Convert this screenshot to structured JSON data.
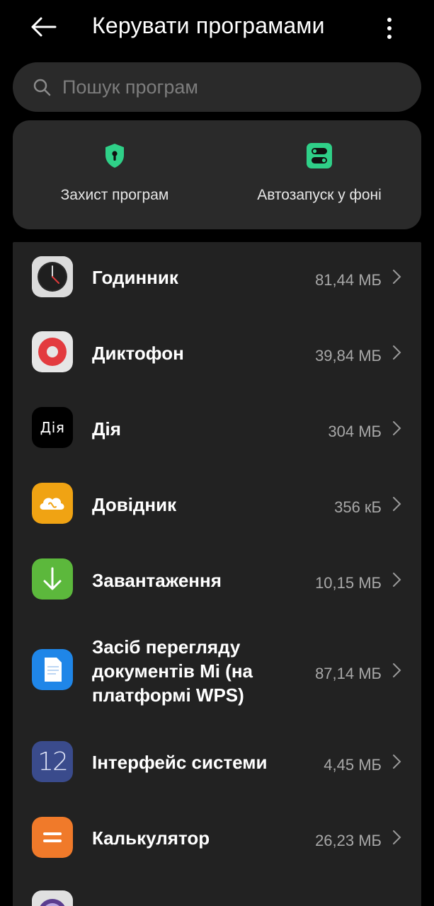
{
  "header": {
    "title": "Керувати програмами",
    "back_icon": "arrow-left-icon",
    "menu_icon": "more-vertical-icon"
  },
  "search": {
    "placeholder": "Пошук програм",
    "icon": "search-icon"
  },
  "quick_actions": [
    {
      "label": "Захист програм",
      "icon": "shield-lock-icon",
      "color": "#2fd088"
    },
    {
      "label": "Автозапуск у фоні",
      "icon": "toggle-switches-icon",
      "color": "#2fd088"
    }
  ],
  "apps": [
    {
      "name": "Годинник",
      "size": "81,44 МБ",
      "icon": "clock-app-icon"
    },
    {
      "name": "Диктофон",
      "size": "39,84 МБ",
      "icon": "recorder-app-icon"
    },
    {
      "name": "Дія",
      "size": "304 МБ",
      "icon": "diia-app-icon",
      "icon_text": "Дія"
    },
    {
      "name": "Довідник",
      "size": "356 кБ",
      "icon": "directory-app-icon"
    },
    {
      "name": "Завантаження",
      "size": "10,15 МБ",
      "icon": "downloads-app-icon"
    },
    {
      "name": "Засіб перегляду документів Mi (на платформі WPS)",
      "name_lines": [
        "Засіб перегляду",
        "документів Mi (на",
        "платформі WPS)"
      ],
      "size": "87,14 МБ",
      "icon": "mi-docs-app-icon"
    },
    {
      "name": "Інтерфейс системи",
      "size": "4,45 МБ",
      "icon": "system-ui-app-icon",
      "icon_text": "12"
    },
    {
      "name": "Калькулятор",
      "size": "26,23 МБ",
      "icon": "calculator-app-icon"
    }
  ],
  "colors": {
    "background": "#000000",
    "surface": "#2a2a2a",
    "list_surface": "#222222",
    "accent_green": "#2fd088",
    "secondary_text": "#a8a8a8"
  }
}
